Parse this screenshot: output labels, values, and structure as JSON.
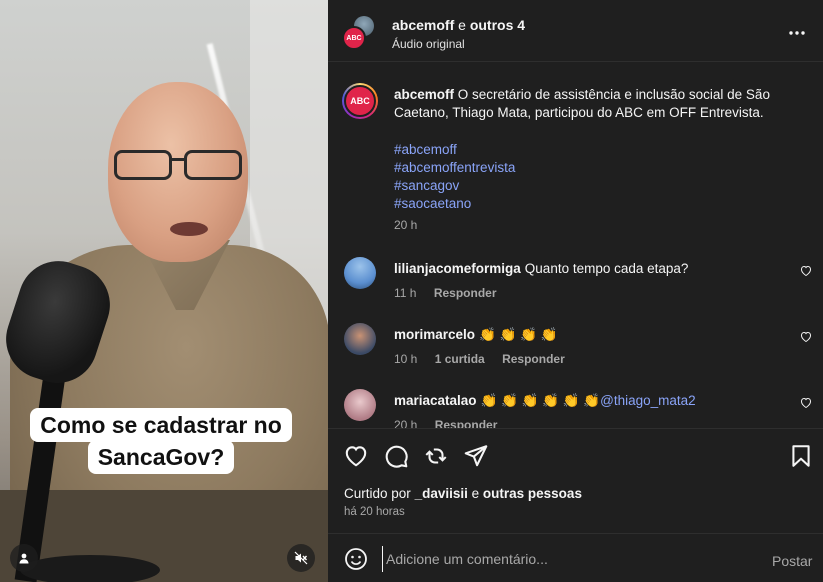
{
  "video": {
    "caption_line1": "Como se cadastrar no",
    "caption_line2": "SancaGov?",
    "user_icon": "person-icon",
    "mute_icon": "muted-speaker-icon"
  },
  "header": {
    "username": "abcemoff",
    "conjunction": "e",
    "others": "outros 4",
    "audio": "Áudio original",
    "more_icon": "more-horizontal-icon",
    "avatar_text": "ABC"
  },
  "post": {
    "username": "abcemoff",
    "caption": "O secretário de assistência e inclusão social de São Caetano, Thiago Mata, participou do ABC em OFF Entrevista.",
    "hashtags": [
      "#abcemoff",
      "#abcemoffentrevista",
      "#sancagov",
      "#saocaetano"
    ],
    "time": "20 h"
  },
  "comments": [
    {
      "username": "lilianjacomeformiga",
      "text": "Quanto tempo cada etapa?",
      "mention": "",
      "time": "11 h",
      "likes": "",
      "reply": "Responder",
      "avatar_color": "#5b8fd0"
    },
    {
      "username": "morimarcelo",
      "text": "👏 👏 👏 👏",
      "mention": "",
      "time": "10 h",
      "likes": "1 curtida",
      "reply": "Responder",
      "avatar_color": "#3b4a66"
    },
    {
      "username": "mariacatalao",
      "text": "👏 👏 👏 👏 👏 👏",
      "mention": "@thiago_mata2",
      "time": "20 h",
      "likes": "",
      "reply": "Responder",
      "avatar_color": "#b07c86"
    }
  ],
  "actions": {
    "like_icon": "heart-icon",
    "comment_icon": "comment-icon",
    "repost_icon": "repost-icon",
    "share_icon": "send-icon",
    "save_icon": "bookmark-icon"
  },
  "likes": {
    "prefix": "Curtido por",
    "user": "_daviisii",
    "conjunction": "e",
    "others": "outras pessoas",
    "ago": "há 20 horas"
  },
  "comment_box": {
    "placeholder": "Adicione um comentário...",
    "post_label": "Postar",
    "emoji_icon": "emoji-icon"
  }
}
